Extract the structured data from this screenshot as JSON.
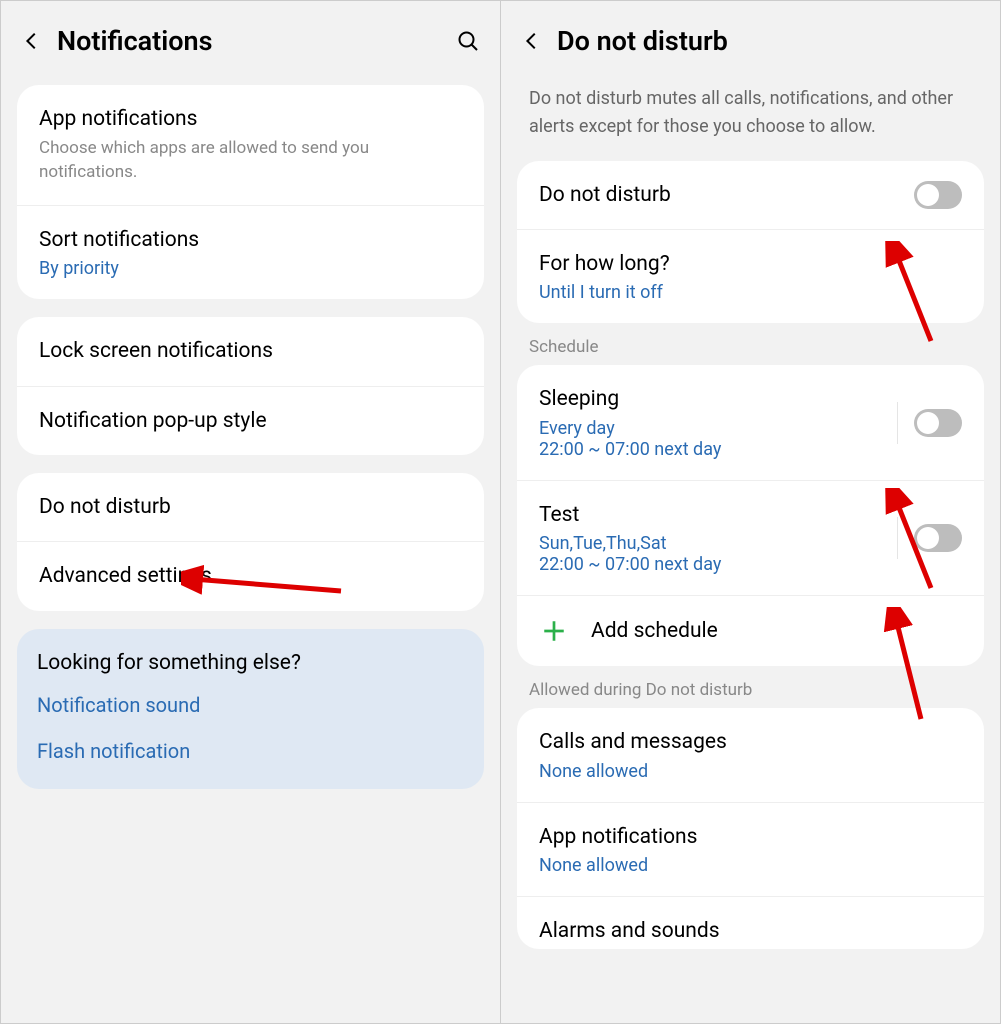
{
  "left": {
    "header": {
      "title": "Notifications"
    },
    "card1": {
      "appNotifications": {
        "title": "App notifications",
        "sub": "Choose which apps are allowed to send you notifications."
      },
      "sort": {
        "title": "Sort notifications",
        "link": "By priority"
      }
    },
    "card2": {
      "lockScreen": {
        "title": "Lock screen notifications"
      },
      "popup": {
        "title": "Notification pop-up style"
      }
    },
    "card3": {
      "dnd": {
        "title": "Do not disturb"
      },
      "advanced": {
        "title": "Advanced settings"
      }
    },
    "highlight": {
      "title": "Looking for something else?",
      "link1": "Notification sound",
      "link2": "Flash notification"
    }
  },
  "right": {
    "header": {
      "title": "Do not disturb"
    },
    "description": "Do not disturb mutes all calls, notifications, and other alerts except for those you choose to allow.",
    "card1": {
      "toggle": {
        "title": "Do not disturb"
      },
      "howLong": {
        "title": "For how long?",
        "link": "Until I turn it off"
      }
    },
    "scheduleLabel": "Schedule",
    "card2": {
      "sleeping": {
        "title": "Sleeping",
        "days": "Every day",
        "time": "22:00 ~ 07:00 next day"
      },
      "test": {
        "title": "Test",
        "days": "Sun,Tue,Thu,Sat",
        "time": "22:00 ~ 07:00 next day"
      },
      "add": {
        "label": "Add schedule"
      }
    },
    "allowedLabel": "Allowed during Do not disturb",
    "card3": {
      "calls": {
        "title": "Calls and messages",
        "link": "None allowed"
      },
      "appNotif": {
        "title": "App notifications",
        "link": "None allowed"
      },
      "alarms": {
        "title": "Alarms and sounds"
      }
    }
  }
}
